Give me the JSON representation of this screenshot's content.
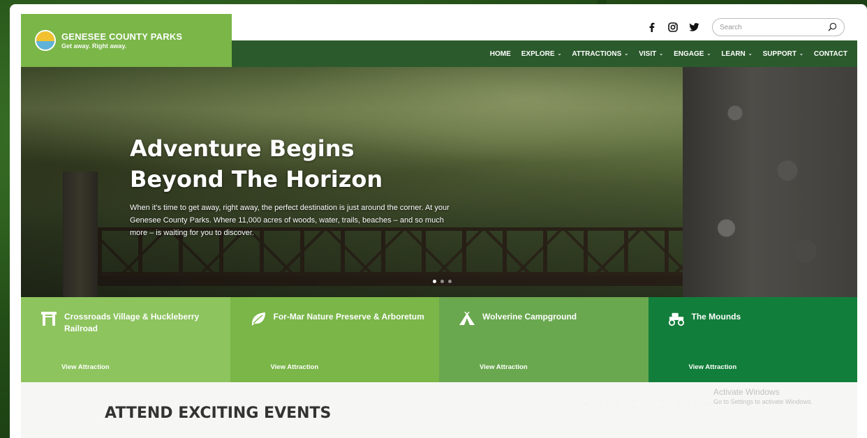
{
  "brand": {
    "title": "GENESEE COUNTY PARKS",
    "tagline": "Get away. Right away."
  },
  "social": [
    "facebook-icon",
    "instagram-icon",
    "twitter-icon"
  ],
  "search": {
    "placeholder": "Search",
    "value": ""
  },
  "nav": {
    "items": [
      {
        "label": "HOME",
        "dropdown": false
      },
      {
        "label": "EXPLORE",
        "dropdown": true
      },
      {
        "label": "ATTRACTIONS",
        "dropdown": true
      },
      {
        "label": "VISIT",
        "dropdown": true
      },
      {
        "label": "ENGAGE",
        "dropdown": true
      },
      {
        "label": "LEARN",
        "dropdown": true
      },
      {
        "label": "SUPPORT",
        "dropdown": true
      },
      {
        "label": "CONTACT",
        "dropdown": false
      }
    ]
  },
  "hero": {
    "title_line1": "Adventure Begins",
    "title_line2": "Beyond The Horizon",
    "body": "When it's time to get away, right away, the perfect destination is just around the corner. At your Genesee County Parks. Where 11,000 acres of woods, water, trails, beaches – and so much more – is waiting for you to discover."
  },
  "tiles": [
    {
      "title": "Crossroads Village & Huckleberry Railroad",
      "link": "View Attraction",
      "icon": "gate-icon",
      "color": "#8dc45e"
    },
    {
      "title": "For-Mar Nature Preserve & Arboretum",
      "link": "View Attraction",
      "icon": "leaf-icon",
      "color": "#7ab648"
    },
    {
      "title": "Wolverine Campground",
      "link": "View Attraction",
      "icon": "tent-icon",
      "color": "#6aa84f"
    },
    {
      "title": "The Mounds",
      "link": "View Attraction",
      "icon": "offroad-vehicle-icon",
      "color": "#127e3b"
    }
  ],
  "events": {
    "title": "ATTEND EXCITING EVENTS"
  },
  "watermark": {
    "line1": "Activate Windows",
    "line2": "Go to Settings to activate Windows."
  }
}
